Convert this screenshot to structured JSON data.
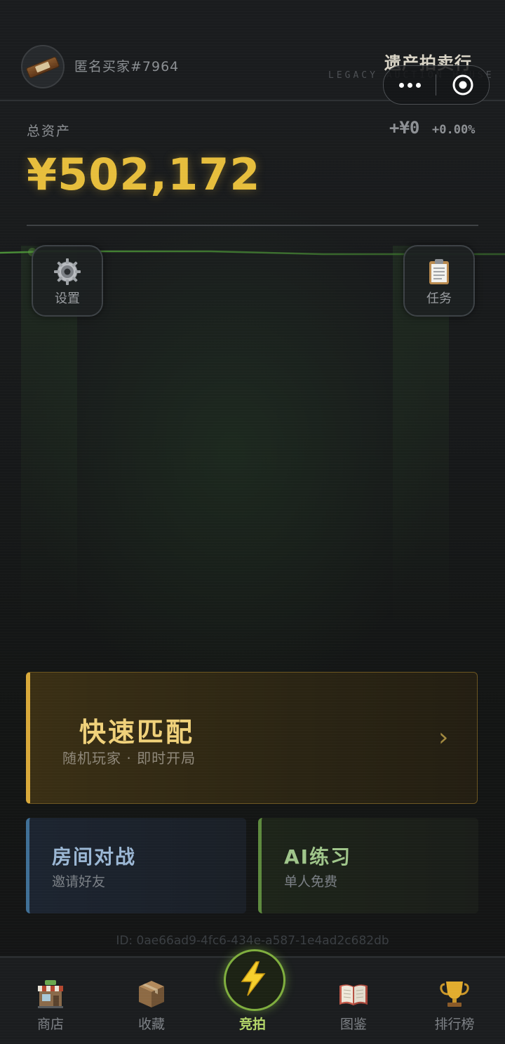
{
  "header": {
    "username": "匿名买家#7964",
    "brand_title": "遗产拍卖行",
    "brand_subtitle": "LEGACY AUCTION HOUSE"
  },
  "assets": {
    "label": "总资产",
    "total": "¥502,172",
    "change_amount": "+¥0",
    "change_percent": "+0.00%"
  },
  "side_buttons": {
    "settings": "设置",
    "tasks": "任务"
  },
  "quick_match": {
    "title": "快速匹配",
    "subtitle": "随机玩家 · 即时开局",
    "arrow": "›"
  },
  "room_battle": {
    "title": "房间对战",
    "subtitle": "邀请好友"
  },
  "ai_practice": {
    "title": "AI练习",
    "subtitle": "单人免费"
  },
  "user_id": "ID: 0ae66ad9-4fc6-434e-a587-1e4ad2c682db",
  "tabs": [
    {
      "label": "商店",
      "icon": "shop-icon"
    },
    {
      "label": "收藏",
      "icon": "box-icon"
    },
    {
      "label": "竞拍",
      "icon": "lightning-icon"
    },
    {
      "label": "图鉴",
      "icon": "book-icon"
    },
    {
      "label": "排行榜",
      "icon": "trophy-icon"
    }
  ],
  "colors": {
    "gold": "#e7be3c",
    "accent_green": "#7fae3e",
    "room_blue": "#3f6f96"
  }
}
